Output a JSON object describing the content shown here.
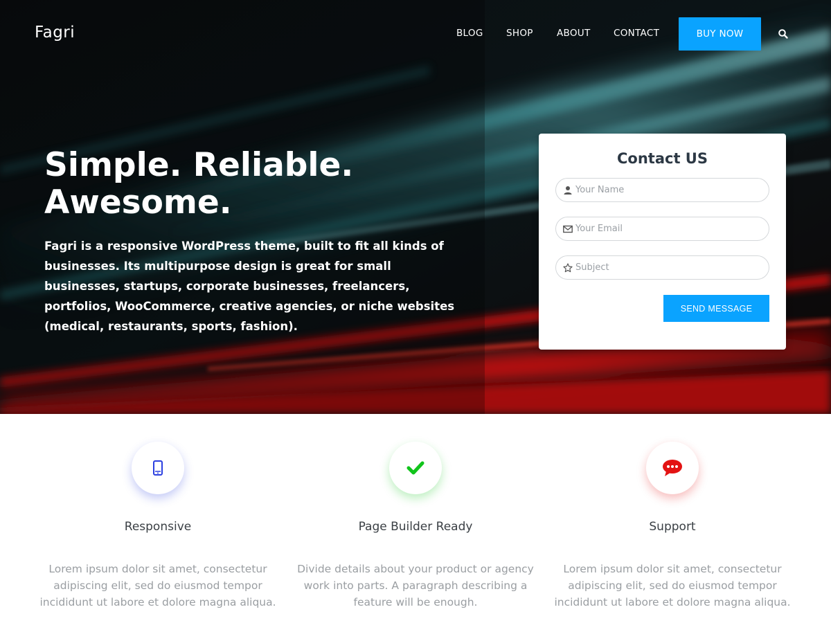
{
  "header": {
    "logo": "Fagri",
    "nav": [
      {
        "label": "BLOG"
      },
      {
        "label": "SHOP"
      },
      {
        "label": "ABOUT"
      },
      {
        "label": "CONTACT"
      }
    ],
    "buy_now_label": "BUY NOW",
    "search_icon": "search-icon"
  },
  "hero": {
    "title_line1": "Simple. Reliable.",
    "title_line2": "Awesome.",
    "description": "Fagri is a responsive WordPress theme, built to fit all kinds of businesses. Its multipurpose design is great for small businesses, startups, corporate businesses, freelancers, portfolios, WooCommerce, creative agencies, or niche websites (medical, restaurants, sports, fashion)."
  },
  "contact": {
    "title": "Contact US",
    "name_placeholder": "Your Name",
    "email_placeholder": "Your Email",
    "subject_placeholder": "Subject",
    "send_label": "SEND MESSAGE"
  },
  "features": [
    {
      "icon": "mobile-icon",
      "color": "#2b3fe0",
      "title": "Responsive",
      "text": "Lorem ipsum dolor sit amet, consectetur adipiscing elit, sed do eiusmod tempor incididunt ut labore et dolore magna aliqua."
    },
    {
      "icon": "checkmark-icon",
      "color": "#11c41b",
      "title": "Page Builder Ready",
      "text": "Divide details about your product or agency work into parts. A paragraph describing a feature will be enough."
    },
    {
      "icon": "chat-bubble-icon",
      "color": "#e31313",
      "title": "Support",
      "text": "Lorem ipsum dolor sit amet, consectetur adipiscing elit, sed do eiusmod tempor incididunt ut labore et dolore magna aliqua."
    }
  ],
  "colors": {
    "accent": "#0aa3ff",
    "heading": "#2c3844",
    "muted_text": "#9a9ea2"
  }
}
